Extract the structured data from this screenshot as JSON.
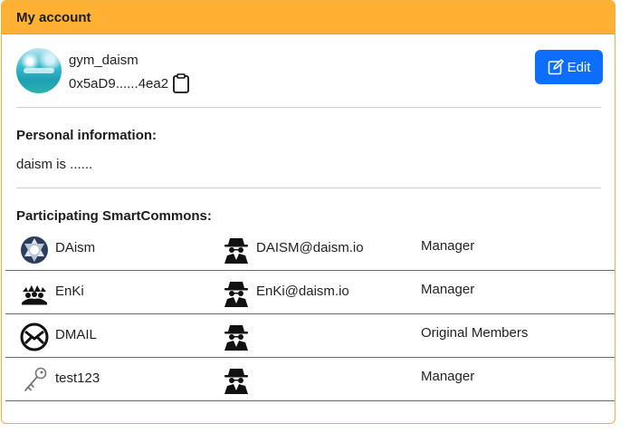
{
  "header": {
    "title": "My account"
  },
  "profile": {
    "username": "gym_daism",
    "address": "0x5aD9......4ea2",
    "edit_label": "Edit"
  },
  "personal": {
    "title": "Personal information:",
    "text": "daism is ......"
  },
  "commons": {
    "title": "Participating SmartCommons:",
    "rows": [
      {
        "name": "DAism",
        "icon": "daism-logo-icon",
        "email": "DAISM@daism.io",
        "role": "Manager"
      },
      {
        "name": "EnKi",
        "icon": "enki-logo-icon",
        "email": "EnKi@daism.io",
        "role": "Manager"
      },
      {
        "name": "DMAIL",
        "icon": "dmail-logo-icon",
        "email": "",
        "role": "Original Members"
      },
      {
        "name": "test123",
        "icon": "key-icon",
        "email": "",
        "role": "Manager"
      }
    ]
  },
  "colors": {
    "header_bg": "#ffb133",
    "border": "#f2b13a",
    "button_bg": "#0d6efd"
  }
}
